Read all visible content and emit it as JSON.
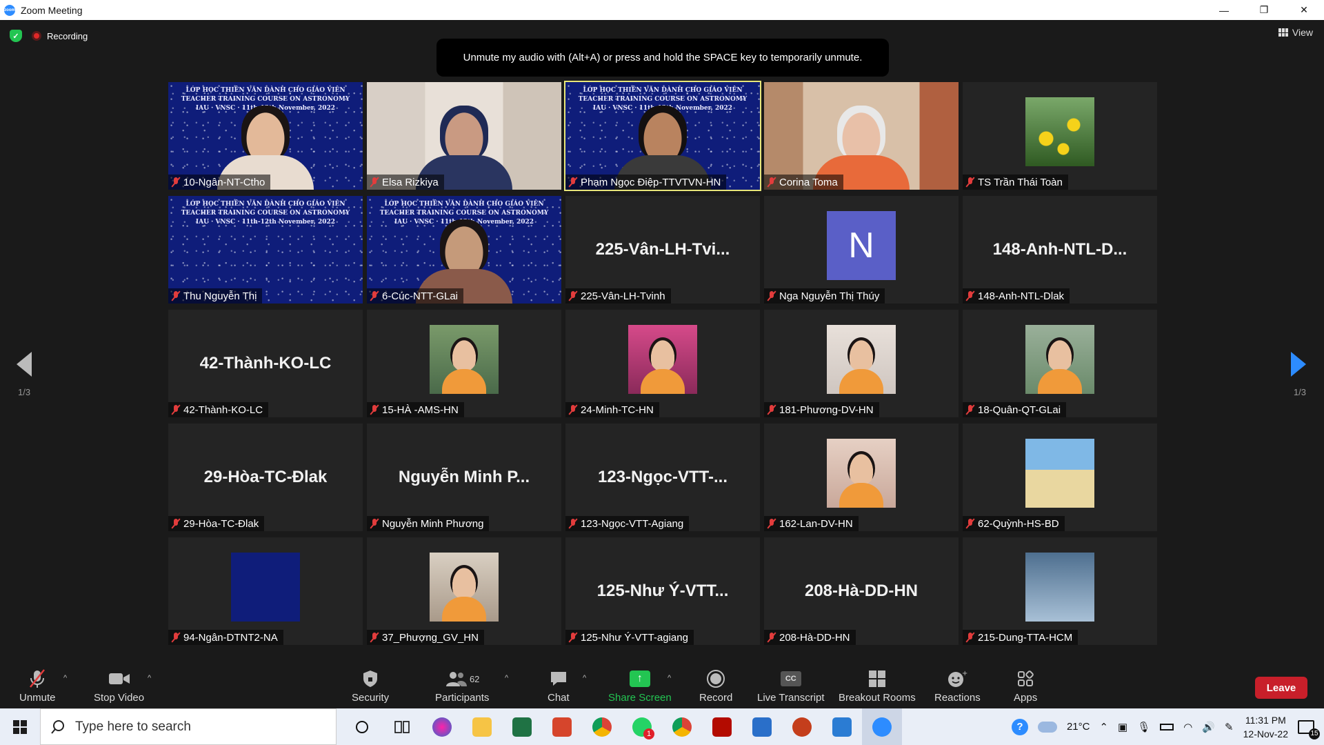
{
  "window": {
    "title": "Zoom Meeting",
    "minimize": "—",
    "restore": "❐",
    "close": "✕"
  },
  "top": {
    "recording_label": "Recording",
    "view_label": "View"
  },
  "tooltip": "Unmute my audio with (Alt+A) or press and hold the SPACE key to temporarily unmute.",
  "pagination": {
    "left": "1/3",
    "right": "1/3"
  },
  "banner": {
    "line1": "LỚP HỌC THIÊN VĂN DÀNH CHO GIÁO VIÊN",
    "line2": "TEACHER TRAINING COURSE ON ASTRONOMY",
    "line3": "IAU · VNSC · 11th-12th November, 2022"
  },
  "tiles": [
    {
      "label": "10-Ngân-NT-Ctho",
      "kind": "banner-person",
      "skin": "#e3b999",
      "hair": "#1a1414",
      "shirt": "#e8dcd0"
    },
    {
      "label": "Elsa Rizkiya",
      "kind": "room-person",
      "skin": "#c99a82",
      "hair": "#1f2a55",
      "shirt": "#2a3560"
    },
    {
      "label": "Phạm Ngọc Điệp-TTVTVN-HN",
      "kind": "banner-person",
      "skin": "#b9835f",
      "hair": "#141010",
      "shirt": "#3a3a3a",
      "active": true
    },
    {
      "label": "Corina Toma",
      "kind": "home-person",
      "skin": "#e8c0a8",
      "hair": "#e8e8e8",
      "shirt": "#e86a3a"
    },
    {
      "label": "TS Trần Thái Toàn",
      "kind": "photo",
      "photo": "flowers"
    },
    {
      "label": "Thu Nguyễn Thị",
      "kind": "banner"
    },
    {
      "label": "6-Cúc-NTT-GLai",
      "kind": "banner-person",
      "skin": "#c59a7a",
      "hair": "#1a1414",
      "shirt": "#8a5a4a"
    },
    {
      "label": "225-Vân-LH-Tvinh",
      "kind": "name",
      "display": "225-Vân-LH-Tvi..."
    },
    {
      "label": "Nga Nguyễn Thị Thúy",
      "kind": "letter",
      "letter": "N"
    },
    {
      "label": "148-Anh-NTL-Dlak",
      "kind": "name",
      "display": "148-Anh-NTL-D..."
    },
    {
      "label": "42-Thành-KO-LC",
      "kind": "name",
      "display": "42-Thành-KO-LC"
    },
    {
      "label": "15-HÀ -AMS-HN",
      "kind": "photo",
      "photo": "woman-green"
    },
    {
      "label": "24-Minh-TC-HN",
      "kind": "photo",
      "photo": "woman-pink"
    },
    {
      "label": "181-Phương-DV-HN",
      "kind": "photo",
      "photo": "woman-light"
    },
    {
      "label": "18-Quân-QT-GLai",
      "kind": "photo",
      "photo": "woman-outdoor"
    },
    {
      "label": "29-Hòa-TC-Đlak",
      "kind": "name",
      "display": "29-Hòa-TC-Đlak"
    },
    {
      "label": "Nguyễn Minh Phương",
      "kind": "name",
      "display": "Nguyễn Minh P..."
    },
    {
      "label": "123-Ngọc-VTT-Agiang",
      "kind": "name",
      "display": "123-Ngọc-VTT-..."
    },
    {
      "label": "162-Lan-DV-HN",
      "kind": "photo",
      "photo": "woman-party"
    },
    {
      "label": "62-Quỳnh-HS-BD",
      "kind": "photo",
      "photo": "beach"
    },
    {
      "label": "94-Ngân-DTNT2-NA",
      "kind": "photo",
      "photo": "banner-small"
    },
    {
      "label": "37_Phượng_GV_HN",
      "kind": "photo",
      "photo": "woman-flowers"
    },
    {
      "label": "125-Như Ý-VTT-agiang",
      "kind": "name",
      "display": "125-Như Ý-VTT..."
    },
    {
      "label": "208-Hà-DD-HN",
      "kind": "name",
      "display": "208-Hà-DD-HN"
    },
    {
      "label": "215-Dung-TTA-HCM",
      "kind": "photo",
      "photo": "plane"
    }
  ],
  "toolbar": {
    "unmute": "Unmute",
    "stop_video": "Stop Video",
    "security": "Security",
    "participants": "Participants",
    "participant_count": "62",
    "chat": "Chat",
    "share_screen": "Share Screen",
    "record": "Record",
    "live_transcript": "Live Transcript",
    "live_transcript_icon": "CC",
    "breakout_rooms": "Breakout Rooms",
    "reactions": "Reactions",
    "apps": "Apps",
    "leave": "Leave"
  },
  "taskbar": {
    "search_placeholder": "Type here to search",
    "weather": "21°C",
    "time": "11:31 PM",
    "date": "12-Nov-22",
    "notification_count": "15",
    "whatsapp_badge": "1"
  }
}
